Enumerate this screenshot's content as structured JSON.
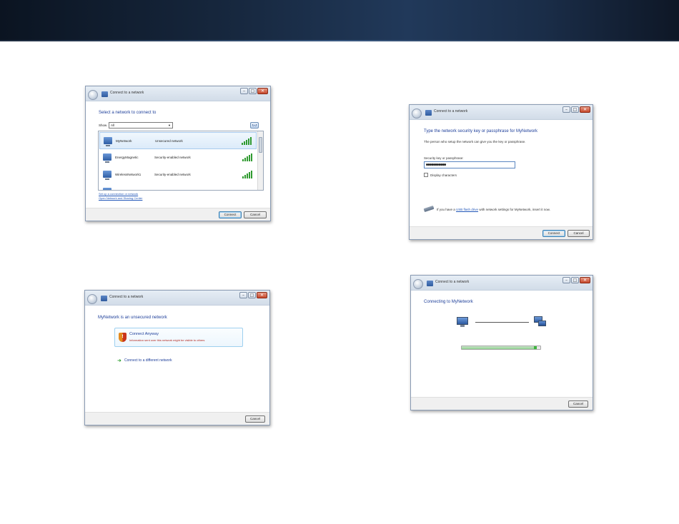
{
  "colors": {
    "heading_blue": "#1e3f9a",
    "link_blue": "#2156b8",
    "warning_red": "#b3261e",
    "signal_green": "#2f9a2f"
  },
  "window": {
    "title": "Connect to a network",
    "minimize_icon": "minimize-icon",
    "maximize_icon": "maximize-icon",
    "close_icon": "close-icon"
  },
  "dialog_select": {
    "heading": "Select a network to connect to",
    "show_label": "Show",
    "show_value": "All",
    "refresh_icon": "refresh-icon",
    "networks": [
      {
        "name": "MyNetwork",
        "security": "Unsecured network",
        "signal_bars": 5
      },
      {
        "name": "EnergyMagnetic",
        "security": "Security-enabled network",
        "signal_bars": 5
      },
      {
        "name": "WirelessNetwork1",
        "security": "Security-enabled network",
        "signal_bars": 5
      }
    ],
    "link_setup": "Set up a connection or network",
    "link_center": "Open Network and Sharing Center",
    "connect_label": "Connect",
    "cancel_label": "Cancel"
  },
  "dialog_unsecured": {
    "heading": "MyNetwork is an unsecured network",
    "option_title": "Connect Anyway",
    "option_sub": "Information sent over this network might be visible to others",
    "alt_option": "Connect to a different network",
    "cancel_label": "Cancel"
  },
  "dialog_key": {
    "heading": "Type the network security key or passphrase for MyNetwork",
    "description": "The person who setup the network can give you the key or passphrase.",
    "field_label": "Security key or passphrase:",
    "field_value": "●●●●●●●●●●●",
    "display_characters": "Display characters",
    "usb_text_before": "If you have a",
    "usb_link": "USB flash drive",
    "usb_text_after": "with network settings for MyNetwork, insert it now.",
    "connect_label": "Connect",
    "cancel_label": "Cancel"
  },
  "dialog_connecting": {
    "heading": "Connecting to MyNetwork",
    "progress": 0.95,
    "cancel_label": "Cancel"
  }
}
